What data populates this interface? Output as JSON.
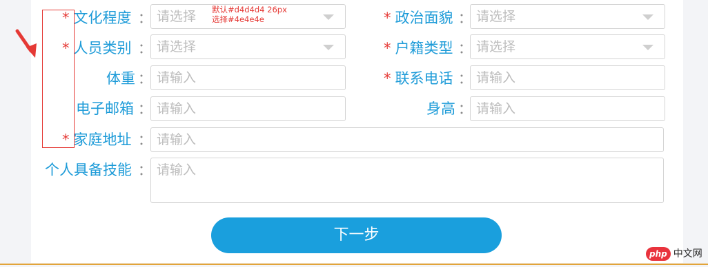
{
  "form": {
    "rows": [
      {
        "left": {
          "label": "文化程度",
          "required": true,
          "colon": "：",
          "value": "请选择",
          "type": "select"
        },
        "right": {
          "label": "政治面貌",
          "required": true,
          "colon": "：",
          "value": "请选择",
          "type": "select"
        }
      },
      {
        "left": {
          "label": "人员类别",
          "required": true,
          "colon": "：",
          "value": "请选择",
          "type": "select"
        },
        "right": {
          "label": "户籍类型",
          "required": true,
          "colon": "：",
          "value": "请选择",
          "type": "select"
        }
      },
      {
        "left": {
          "label": "体重",
          "required": false,
          "colon": "：",
          "value": "请输入",
          "type": "input"
        },
        "right": {
          "label": "联系电话",
          "required": true,
          "colon": "：",
          "value": "请输入",
          "type": "input"
        }
      },
      {
        "left": {
          "label": "电子邮箱",
          "required": false,
          "colon": "：",
          "value": "请输入",
          "type": "input"
        },
        "right": {
          "label": "身高",
          "required": false,
          "colon": "：",
          "value": "请输入",
          "type": "input"
        }
      },
      {
        "full": {
          "label": "家庭地址",
          "required": true,
          "colon": "：",
          "value": "请输入",
          "type": "input"
        }
      },
      {
        "full": {
          "label": "个人具备技能",
          "required": false,
          "colon": "：",
          "value": "请输入",
          "type": "textarea"
        }
      }
    ],
    "required_mark": "*",
    "next_button": "下一步"
  },
  "annotation": {
    "line1": "默认#d4d4d4   26px",
    "line2": "选择#4e4e4e"
  },
  "colors": {
    "label": "#1d9bd8",
    "required": "#e53935",
    "border_default": "#d4d4d4",
    "border_selected": "#4e4e4e",
    "button": "#1a9fdd",
    "placeholder": "#bdbdbd"
  },
  "watermark": {
    "badge": "php",
    "text": "中文网"
  },
  "icons": [
    "chevron-down-icon",
    "annotation-arrow-icon"
  ]
}
